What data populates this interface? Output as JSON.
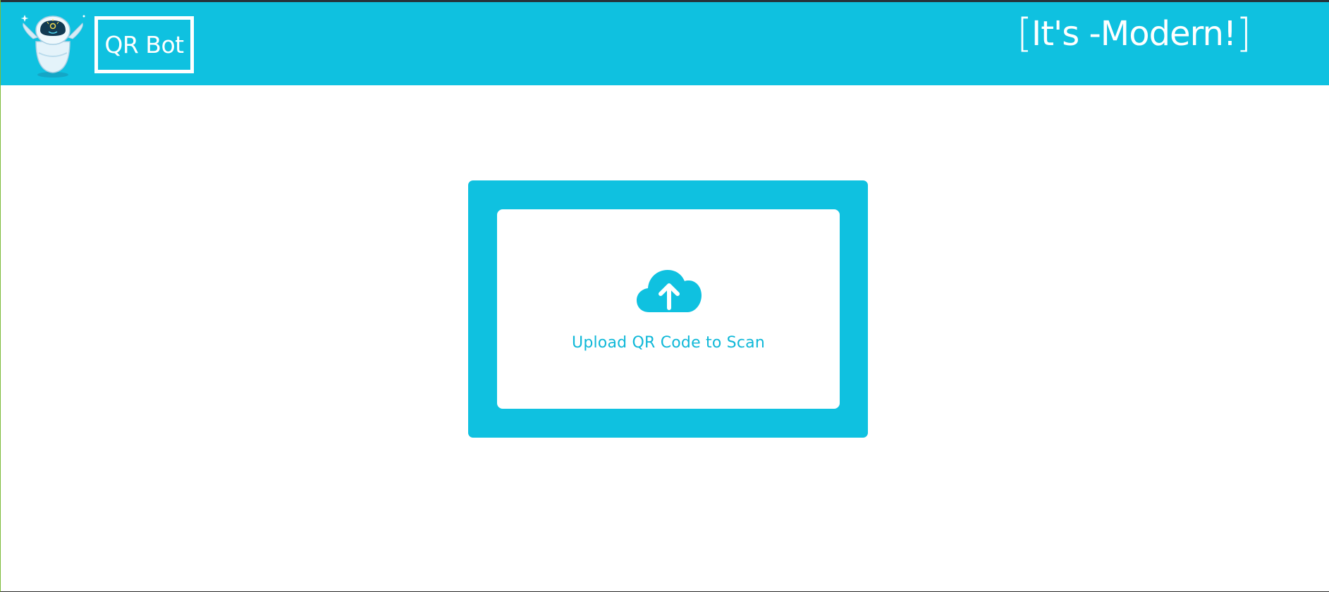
{
  "header": {
    "brand": "QR Bot",
    "tagline_open": "[",
    "tagline_text": "It's -Modern!",
    "tagline_close": "]",
    "logo_icon": "robot-mascot-icon"
  },
  "upload": {
    "label": "Upload QR Code to Scan",
    "icon": "cloud-upload-icon"
  },
  "colors": {
    "accent": "#0fc1e0",
    "background": "#ffffff",
    "text_on_accent": "#ffffff"
  }
}
